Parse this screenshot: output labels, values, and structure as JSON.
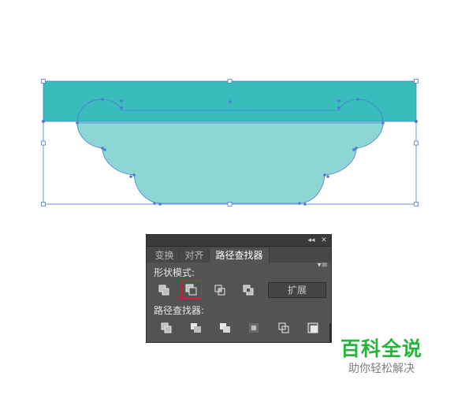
{
  "colors": {
    "top_rect": "#3bbcbc",
    "shape_fill": "#8dd6d4",
    "selection": "#4a7bd6",
    "panel_bg": "#535353",
    "highlight": "#e0242a",
    "watermark_green": "#27b43a"
  },
  "panel": {
    "collapse_glyph": "◂◂",
    "close_glyph": "✕",
    "tabs": [
      {
        "label": "变换",
        "active": false
      },
      {
        "label": "对齐",
        "active": false
      },
      {
        "label": "路径查找器",
        "active": true
      }
    ],
    "menu_glyph": "▾≡",
    "shape_modes_label": "形状模式:",
    "shape_mode_icons": [
      "unite-icon",
      "minus-front-icon",
      "intersect-icon",
      "exclude-icon"
    ],
    "highlighted_icon": "minus-front-icon",
    "expand_label": "扩展",
    "pathfinders_label": "路径查找器:",
    "pathfinder_icons": [
      "divide-icon",
      "trim-icon",
      "merge-icon",
      "crop-icon",
      "outline-icon",
      "minus-back-icon"
    ]
  },
  "watermark": {
    "title": "百科全说",
    "subtitle": "助你轻松解决"
  }
}
